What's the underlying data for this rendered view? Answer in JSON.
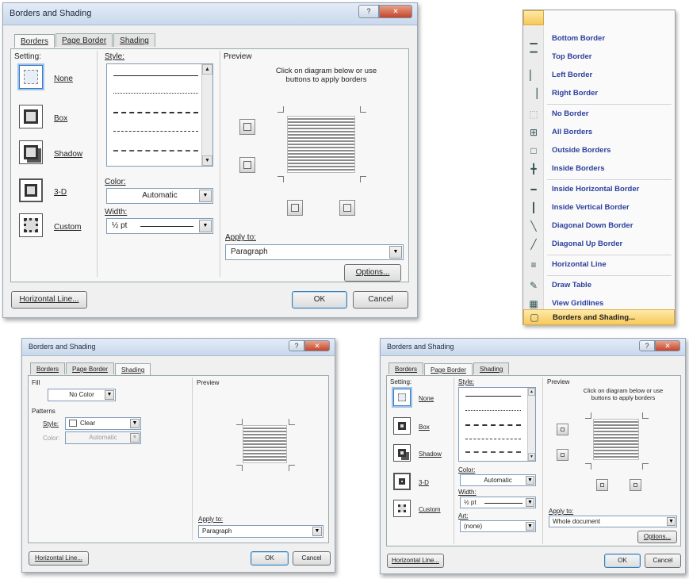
{
  "dialog1": {
    "title": "Borders and Shading",
    "tabs": [
      "Borders",
      "Page Border",
      "Shading"
    ],
    "setting_label": "Setting:",
    "settings": [
      "None",
      "Box",
      "Shadow",
      "3-D",
      "Custom"
    ],
    "style_label": "Style:",
    "color_label": "Color:",
    "color_value": "Automatic",
    "width_label": "Width:",
    "width_value": "½ pt",
    "preview_label": "Preview",
    "preview_hint": "Click on diagram below or use buttons to apply borders",
    "apply_to_label": "Apply to:",
    "apply_to_value": "Paragraph",
    "options_button": "Options...",
    "horizontal_line_button": "Horizontal Line...",
    "ok_button": "OK",
    "cancel_button": "Cancel"
  },
  "menu": {
    "items": [
      {
        "label": "Bottom Border",
        "icon": "bottom-border-icon"
      },
      {
        "label": "Top Border",
        "icon": "top-border-icon"
      },
      {
        "label": "Left Border",
        "icon": "left-border-icon"
      },
      {
        "label": "Right Border",
        "icon": "right-border-icon"
      },
      {
        "label": "No Border",
        "icon": "no-border-icon"
      },
      {
        "label": "All Borders",
        "icon": "all-borders-icon"
      },
      {
        "label": "Outside Borders",
        "icon": "outside-borders-icon"
      },
      {
        "label": "Inside Borders",
        "icon": "inside-borders-icon"
      },
      {
        "label": "Inside Horizontal Border",
        "icon": "inside-horizontal-border-icon"
      },
      {
        "label": "Inside Vertical Border",
        "icon": "inside-vertical-border-icon"
      },
      {
        "label": "Diagonal Down Border",
        "icon": "diagonal-down-border-icon"
      },
      {
        "label": "Diagonal Up Border",
        "icon": "diagonal-up-border-icon"
      },
      {
        "label": "Horizontal Line",
        "icon": "horizontal-line-icon"
      },
      {
        "label": "Draw Table",
        "icon": "draw-table-icon"
      },
      {
        "label": "View Gridlines",
        "icon": "view-gridlines-icon"
      },
      {
        "label": "Borders and Shading...",
        "icon": "borders-and-shading-icon"
      }
    ]
  },
  "dialog2": {
    "title": "Borders and Shading",
    "tabs": [
      "Borders",
      "Page Border",
      "Shading"
    ],
    "fill_label": "Fill",
    "fill_value": "No Color",
    "patterns_label": "Patterns",
    "style_label": "Style:",
    "style_value": "Clear",
    "color_label": "Color:",
    "color_value": "Automatic",
    "preview_label": "Preview",
    "apply_to_label": "Apply to:",
    "apply_to_value": "Paragraph",
    "horizontal_line_button": "Horizontal Line...",
    "ok_button": "OK",
    "cancel_button": "Cancel"
  },
  "dialog3": {
    "title": "Borders and Shading",
    "tabs": [
      "Borders",
      "Page Border",
      "Shading"
    ],
    "setting_label": "Setting:",
    "settings": [
      "None",
      "Box",
      "Shadow",
      "3-D",
      "Custom"
    ],
    "style_label": "Style:",
    "color_label": "Color:",
    "color_value": "Automatic",
    "width_label": "Width:",
    "width_value": "½ pt",
    "art_label": "Art:",
    "art_value": "(none)",
    "preview_label": "Preview",
    "preview_hint": "Click on diagram below or use buttons to apply borders",
    "apply_to_label": "Apply to:",
    "apply_to_value": "Whole document",
    "options_button": "Options...",
    "horizontal_line_button": "Horizontal Line...",
    "ok_button": "OK",
    "cancel_button": "Cancel"
  }
}
